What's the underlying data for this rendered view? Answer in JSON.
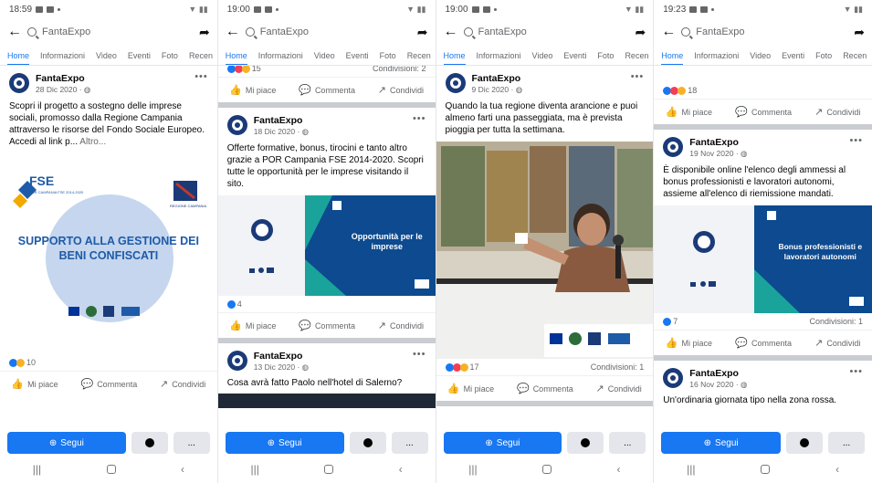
{
  "screens": [
    {
      "time": "18:59",
      "search_placeholder": "FantaExpo",
      "tabs": [
        "Home",
        "Informazioni",
        "Video",
        "Eventi",
        "Foto",
        "Recen"
      ],
      "posts": [
        {
          "page": "FantaExpo",
          "date": "28 Dic 2020 · ",
          "text": "Scopri il progetto a sostegno delle imprese sociali, promosso dalla Regione Campania attraverso le risorse del Fondo Sociale Europeo. Accedi al link p...",
          "more": "Altro...",
          "image_title": "SUPPORTO ALLA GESTIONE DEI BENI CONFISCATI",
          "image_logo": "FSE",
          "image_logo_sub": "POR CAMPANIA FSE 2014-2020",
          "image_region": "REGIONE CAMPANIA",
          "reactions": "10",
          "shares": ""
        }
      ]
    },
    {
      "time": "19:00",
      "search_placeholder": "FantaExpo",
      "tabs": [
        "Home",
        "Informazioni",
        "Video",
        "Eventi",
        "Foto",
        "Recen"
      ],
      "top_reactions": "15",
      "top_shares": "Condivisioni: 2",
      "posts": [
        {
          "page": "FantaExpo",
          "date": "18 Dic 2020 · ",
          "text": "Offerte formative, bonus, tirocini e tanto altro grazie a POR Campania FSE 2014-2020. Scopri tutte le opportunità per le imprese visitando il sito.",
          "image_title": "Opportunità per le imprese",
          "reactions": "4"
        },
        {
          "page": "FantaExpo",
          "date": "13 Dic 2020 · ",
          "text": "Cosa avrà fatto Paolo nell'hotel di Salerno?"
        }
      ]
    },
    {
      "time": "19:00",
      "search_placeholder": "FantaExpo",
      "tabs": [
        "Home",
        "Informazioni",
        "Video",
        "Eventi",
        "Foto",
        "Recen"
      ],
      "posts": [
        {
          "page": "FantaExpo",
          "date": "9 Dic 2020 · ",
          "text": "Quando la tua regione diventa arancione e puoi almeno farti una passeggiata, ma è prevista pioggia per tutta la settimana.",
          "reactions": "17",
          "shares": "Condivisioni: 1"
        }
      ]
    },
    {
      "time": "19:23",
      "search_placeholder": "FantaExpo",
      "tabs": [
        "Home",
        "Informazioni",
        "Video",
        "Eventi",
        "Foto",
        "Recen"
      ],
      "top_reactions": "18",
      "posts": [
        {
          "page": "FantaExpo",
          "date": "19 Nov 2020 · ",
          "text": "È disponibile online l'elenco degli ammessi al bonus professionisti e lavoratori autonomi, assieme all'elenco di riemissione mandati.",
          "image_title": "Bonus professionisti e lavoratori autonomi",
          "reactions": "7",
          "shares": "Condivisioni: 1"
        },
        {
          "page": "FantaExpo",
          "date": "16 Nov 2020 · ",
          "text": "Un'ordinaria giornata tipo nella zona rossa."
        }
      ]
    }
  ],
  "actions": {
    "like": "Mi piace",
    "comment": "Commenta",
    "share": "Condividi"
  },
  "buttons": {
    "follow": "Segui",
    "more": "..."
  },
  "colors": {
    "accent": "#1877f2",
    "fse_blue": "#1e5ba8",
    "banner_blue": "#0d4a8f",
    "teal": "#1aa39a"
  },
  "icons": [
    "back-arrow-icon",
    "search-icon",
    "share-arrow-icon",
    "more-dots-icon",
    "like-icon",
    "comment-icon",
    "share-icon",
    "messenger-icon",
    "nav-recent-icon",
    "nav-home-icon",
    "nav-back-icon"
  ]
}
